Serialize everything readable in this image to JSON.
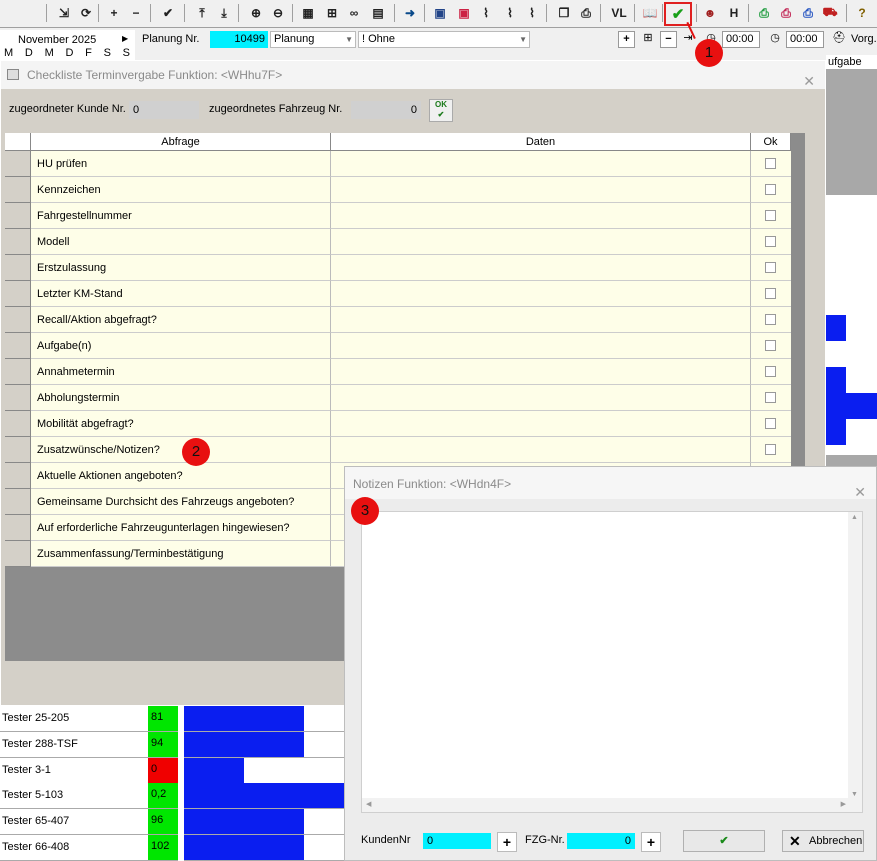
{
  "toolbar": {
    "buttons": [
      "login-icon",
      "refresh-icon",
      "add-icon",
      "remove-icon",
      "check-icon",
      "first-icon",
      "last-icon",
      "zoom-in-icon",
      "zoom-out-icon",
      "calendar-icon",
      "network-icon",
      "binoculars-icon",
      "document-icon",
      "arrow-right-icon",
      "monitor-icon",
      "calendar-red-icon",
      "workflow-icon",
      "workflow2-icon",
      "workflow3-icon",
      "copy-icon",
      "print-icon",
      "vl",
      "book-icon",
      "ok-check-icon",
      "people-icon",
      "h",
      "print-green-icon",
      "print-red-icon",
      "print-blue-icon",
      "car-icon",
      "help-icon"
    ],
    "vl_label": "VL",
    "h_label": "H"
  },
  "topband": {
    "month": "November 2025",
    "weekdays": [
      "M",
      "D",
      "M",
      "D",
      "F",
      "S",
      "S"
    ],
    "planung_label": "Planung Nr.",
    "planung_value": "10499",
    "planung_type": "Planung",
    "ohne": "! Ohne",
    "time1": "00:00",
    "time2": "00:00",
    "vorg": "Vorg.",
    "aufgabe": "ufgabe"
  },
  "checklist": {
    "title": "Checkliste Terminvergabe  Funktion: <WHhu7F>",
    "kunde_label": "zugeordneter Kunde Nr.",
    "kunde_value": "0",
    "fahrzeug_label": "zugeordnetes Fahrzeug Nr.",
    "fahrzeug_value": "0",
    "columns": [
      "Abfrage",
      "Daten",
      "Ok"
    ],
    "rows": [
      "HU prüfen",
      "Kennzeichen",
      "Fahrgestellnummer",
      "Modell",
      "Erstzulassung",
      "Letzter KM-Stand",
      "Recall/Aktion abgefragt?",
      "Aufgabe(n)",
      "Annahmetermin",
      "Abholungstermin",
      "Mobilität abgefragt?",
      "Zusatzwünsche/Notizen?",
      "Aktuelle Aktionen angeboten?",
      "Gemeinsame Durchsicht des Fahrzeugs angeboten?",
      "Auf erforderliche Fahrzeugunterlagen hingewiesen?",
      "Zusammenfassung/Terminbestätigung"
    ]
  },
  "notes": {
    "title": "Notizen  Funktion: <WHdn4F>",
    "kunden_label": "KundenNr",
    "kunden_value": "0",
    "fzg_label": "FZG-Nr.",
    "fzg_value": "0",
    "abbrechen": "Abbrechen"
  },
  "testers": [
    {
      "name": "Tester 25-205",
      "value": "81",
      "color": "#00e600"
    },
    {
      "name": "Tester 288-TSF",
      "value": "94",
      "color": "#00e600"
    },
    {
      "name": "Tester 3-1",
      "value": "0",
      "color": "#f00000"
    },
    {
      "name": "Tester 5-103",
      "value": "0,2",
      "color": "#00e600"
    },
    {
      "name": "Tester 65-407",
      "value": "96",
      "color": "#00e600"
    },
    {
      "name": "Tester 66-408",
      "value": "102",
      "color": "#00e600"
    }
  ],
  "badges": [
    "1",
    "2",
    "3"
  ],
  "colors": {
    "accent_blue": "#0a1ef0",
    "cyan": "#00f0ff",
    "badge_red": "#e81010"
  }
}
